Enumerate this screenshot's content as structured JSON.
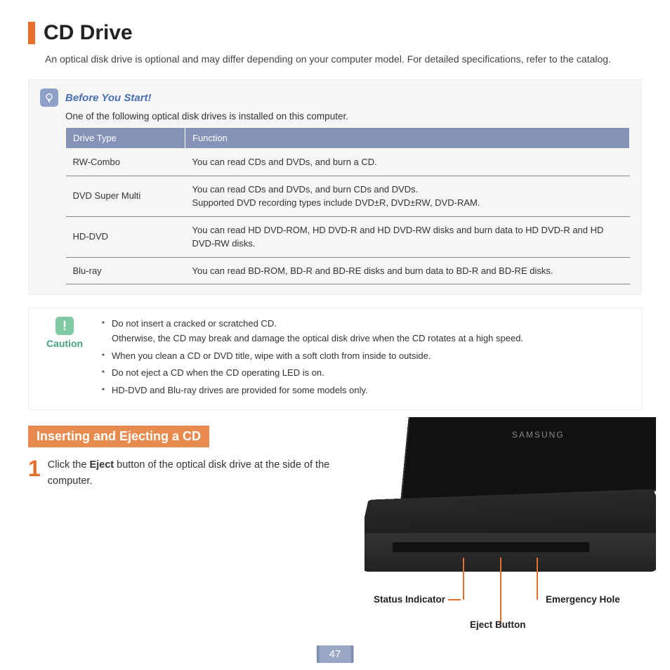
{
  "title": "CD Drive",
  "intro": "An optical disk drive is optional and may differ depending on your computer model. For detailed specifications, refer to the catalog.",
  "before": {
    "heading": "Before You Start!",
    "sub": "One of the following optical disk drives is installed on this computer.",
    "columns": [
      "Drive Type",
      "Function"
    ],
    "rows": [
      {
        "type": "RW-Combo",
        "func": "You can read CDs and DVDs, and burn a CD."
      },
      {
        "type": "DVD Super Multi",
        "func": "You can read CDs and DVDs, and burn CDs and DVDs.\nSupported DVD recording types include DVD±R, DVD±RW, DVD-RAM."
      },
      {
        "type": "HD-DVD",
        "func": "You can read HD DVD-ROM, HD DVD-R and HD DVD-RW disks and burn data to HD DVD-R and HD DVD-RW disks."
      },
      {
        "type": "Blu-ray",
        "func": "You can read BD-ROM, BD-R and BD-RE disks and burn data to BD-R and BD-RE disks."
      }
    ]
  },
  "caution": {
    "label": "Caution",
    "items": [
      "Do not insert a cracked or scratched CD.\nOtherwise, the CD may break and damage the optical disk drive when the CD rotates at a high speed.",
      "When you clean a CD or DVD title, wipe with a soft cloth from inside to outside.",
      "Do not eject a CD when the CD operating LED is on.",
      "HD-DVD and Blu-ray drives are provided for some models only."
    ]
  },
  "section": {
    "title": "Inserting and Ejecting a CD",
    "step_num": "1",
    "step_pre": "Click the ",
    "step_bold": "Eject",
    "step_post": " button of the optical disk drive at the side of the computer."
  },
  "labels": {
    "status": "Status Indicator",
    "eject": "Eject Button",
    "emergency": "Emergency Hole",
    "brand": "SAMSUNG"
  },
  "page": "47"
}
